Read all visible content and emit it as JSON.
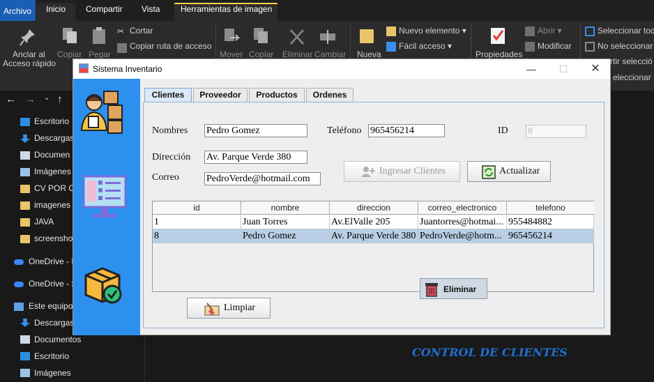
{
  "explorer": {
    "ribbon_tabs": [
      "Archivo",
      "Inicio",
      "Compartir",
      "Vista",
      "Herramientas de imagen"
    ],
    "ribbon": {
      "pin_label_1": "Anclar al",
      "pin_label_2": "Acceso rápido",
      "copy": "Copiar",
      "paste": "Pegar",
      "cut": "Cortar",
      "copy_path": "Copiar ruta de acceso",
      "move": "Mover",
      "copy_to": "Copiar",
      "delete": "Eliminar",
      "rename": "Cambiar",
      "new_folder": "Nueva",
      "new_item": "Nuevo elemento",
      "easy_access": "Fácil acceso",
      "properties": "Propiedades",
      "open": "Abrir",
      "modify": "Modificar",
      "select_all": "Seleccionar tod",
      "select_none": "No seleccionar n",
      "invert_selection": "rtir selecció",
      "select": "eleccionar"
    },
    "sidebar": [
      {
        "label": "Escritorio",
        "icon": "desktop-icon"
      },
      {
        "label": "Descargas",
        "icon": "download-icon"
      },
      {
        "label": "Documen",
        "icon": "document-icon"
      },
      {
        "label": "Imágenes",
        "icon": "image-icon"
      },
      {
        "label": "CV POR CA",
        "icon": "folder-icon"
      },
      {
        "label": "imagenes",
        "icon": "folder-icon"
      },
      {
        "label": "JAVA",
        "icon": "folder-icon"
      },
      {
        "label": "screensho",
        "icon": "folder-icon"
      },
      {
        "label": "OneDrive - I",
        "icon": "cloud-icon"
      },
      {
        "label": "OneDrive - S",
        "icon": "cloud-icon"
      },
      {
        "label": "Este equipo",
        "icon": "computer-icon"
      },
      {
        "label": "Descargas",
        "icon": "download-icon"
      },
      {
        "label": "Documentos",
        "icon": "document-icon"
      },
      {
        "label": "Escritorio",
        "icon": "desktop-icon"
      },
      {
        "label": "Imágenes",
        "icon": "image-icon"
      }
    ]
  },
  "app": {
    "title": "Sistema Inventario",
    "window_controls": {
      "minimize": "—",
      "maximize": "☐",
      "close": "✕"
    },
    "tabs": [
      "Clientes",
      "Proveedor",
      "Productos",
      "Ordenes"
    ],
    "form": {
      "nombre_label": "Nombres",
      "nombre_value": "Pedro Gomez",
      "telefono_label": "Teléfono",
      "telefono_value": "965456214",
      "id_label": "ID",
      "id_value": "8",
      "direccion_label": "Dirección",
      "direccion_value": "Av. Parque Verde 380",
      "correo_label": "Correo",
      "correo_value": "PedroVerde@hotmail.com"
    },
    "buttons": {
      "ingresar": "Ingresar Clientes",
      "actualizar": "Actualizar",
      "limpiar": "Limpiar"
    },
    "table": {
      "columns": [
        "id",
        "nombre",
        "direccion",
        "correo_electronico",
        "telefono"
      ],
      "rows": [
        [
          "1",
          "Juan Torres",
          "Av.ElValle 205",
          "Juantorres@hotmai...",
          "955484882"
        ],
        [
          "8",
          "Pedro Gomez",
          "Av. Parque Verde 380",
          "PedroVerde@hotm...",
          "965456214"
        ]
      ]
    },
    "context_menu": {
      "eliminar": "Eliminar"
    },
    "section_title": "CONTROL DE CLIENTES",
    "colors": {
      "accent": "#2d90ef",
      "title": "#1f6fd1",
      "selected_row": "#b8cfe5"
    }
  }
}
